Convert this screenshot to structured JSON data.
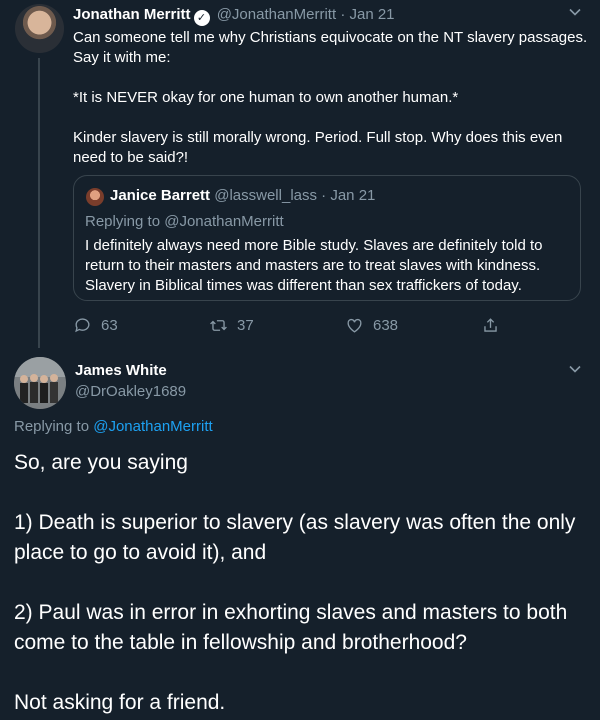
{
  "tweet1": {
    "name": "Jonathan Merritt",
    "handle": "@JonathanMerritt",
    "dot": "·",
    "date": "Jan 21",
    "line1": "Can someone tell me why Christians equivocate on the NT slavery passages. Say it with me:",
    "line2": "*It is NEVER okay for one human to own another human.*",
    "line3": "Kinder slavery is still morally wrong. Period. Full stop. Why does this even need to be said?!",
    "quote": {
      "name": "Janice Barrett",
      "handle": "@lasswell_lass",
      "dot": "·",
      "date": "Jan 21",
      "replying_label": "Replying to",
      "replying_to": "@JonathanMerritt",
      "text": "I definitely always need more Bible study. Slaves are definitely told to return to their masters and masters are to treat slaves with kindness. Slavery in Biblical times was different than sex traffickers of today."
    },
    "actions": {
      "replies": "63",
      "retweets": "37",
      "likes": "638"
    }
  },
  "tweet2": {
    "name": "James White",
    "handle": "@DrOakley1689",
    "replying_label": "Replying to",
    "replying_to": "@JonathanMerritt",
    "para1": "So, are you saying",
    "para2": "1) Death is superior to slavery (as slavery was often the only place to go to avoid it), and",
    "para3": "2) Paul was in error in exhorting slaves and masters to both come to the table in fellowship and brotherhood?",
    "para4": "Not asking for a friend."
  },
  "icons": {
    "verified": "verified-badge-icon",
    "chevron": "chevron-down-icon",
    "reply": "reply-icon",
    "retweet": "retweet-icon",
    "like": "heart-icon",
    "share": "share-icon"
  },
  "colors": {
    "background": "#15202b",
    "muted": "#8899a6",
    "link": "#1da1f2",
    "border": "#38444d"
  }
}
